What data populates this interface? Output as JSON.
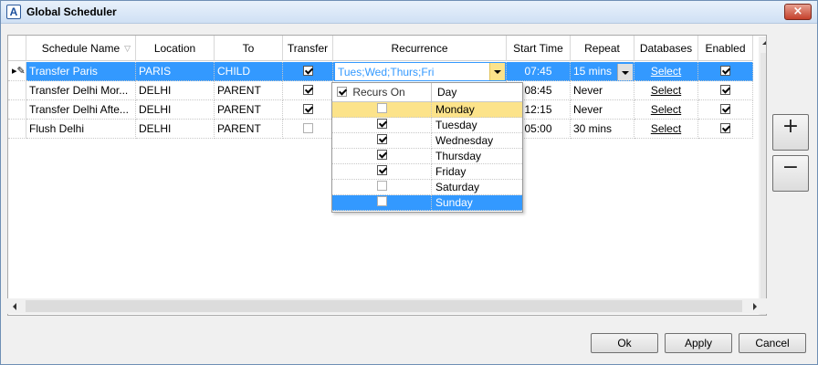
{
  "window": {
    "title": "Global Scheduler",
    "app_icon_glyph": "A",
    "close_glyph": "×"
  },
  "columns": [
    "Schedule Name",
    "Location",
    "To",
    "Transfer",
    "Recurrence",
    "Start Time",
    "Repeat",
    "Databases",
    "Enabled"
  ],
  "rows": [
    {
      "name": "Transfer Paris",
      "location": "PARIS",
      "to": "CHILD",
      "transfer": true,
      "recurrence": "Tues;Wed;Thurs;Fri",
      "start": "07:45",
      "repeat": "15 mins",
      "databases": "Select",
      "enabled": true,
      "selected": true
    },
    {
      "name": "Transfer Delhi Mor...",
      "location": "DELHI",
      "to": "PARENT",
      "transfer": true,
      "recurrence": "",
      "start": "08:45",
      "repeat": "Never",
      "databases": "Select",
      "enabled": true,
      "selected": false
    },
    {
      "name": "Transfer Delhi Afte...",
      "location": "DELHI",
      "to": "PARENT",
      "transfer": true,
      "recurrence": "",
      "start": "12:15",
      "repeat": "Never",
      "databases": "Select",
      "enabled": true,
      "selected": false
    },
    {
      "name": "Flush Delhi",
      "location": "DELHI",
      "to": "PARENT",
      "transfer": false,
      "recurrence": "",
      "start": "05:00",
      "repeat": "30 mins",
      "databases": "Select",
      "enabled": true,
      "selected": false
    }
  ],
  "recurrence_dropdown": {
    "header_check_label": "Recurs On",
    "header_day_label": "Day",
    "days": [
      {
        "day": "Monday",
        "checked": false,
        "state": "highlight"
      },
      {
        "day": "Tuesday",
        "checked": true,
        "state": ""
      },
      {
        "day": "Wednesday",
        "checked": true,
        "state": ""
      },
      {
        "day": "Thursday",
        "checked": true,
        "state": ""
      },
      {
        "day": "Friday",
        "checked": true,
        "state": ""
      },
      {
        "day": "Saturday",
        "checked": false,
        "state": ""
      },
      {
        "day": "Sunday",
        "checked": false,
        "state": "selected"
      }
    ]
  },
  "side_buttons": {
    "add": "+",
    "remove": "−"
  },
  "buttons": {
    "ok": "Ok",
    "apply": "Apply",
    "cancel": "Cancel"
  },
  "colors": {
    "selection": "#3399ff",
    "highlight": "#fce38a"
  }
}
